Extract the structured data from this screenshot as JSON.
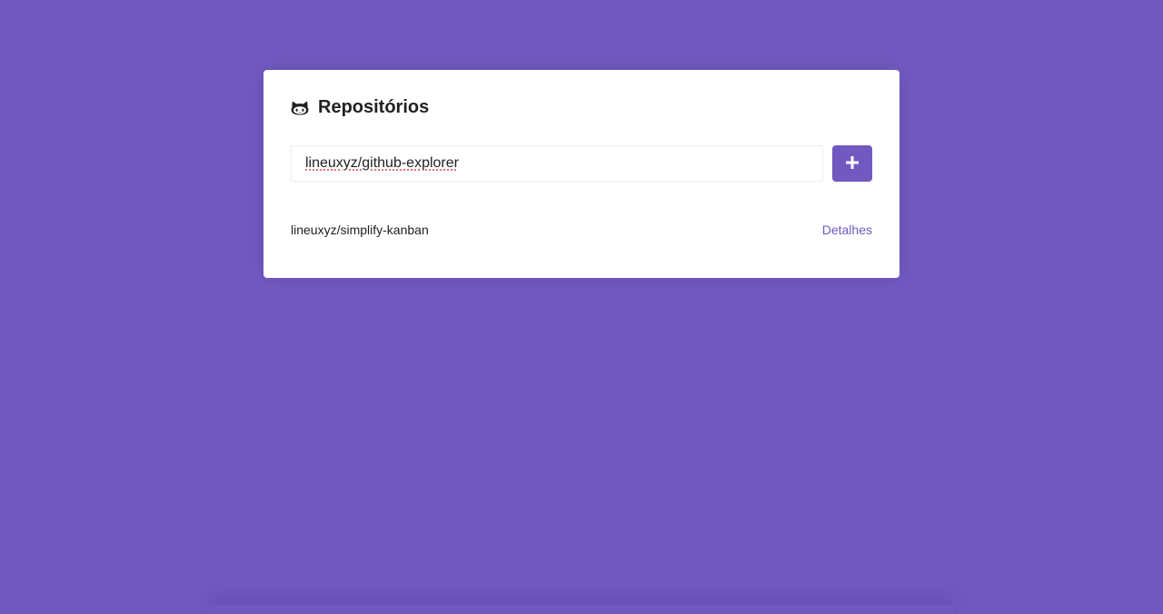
{
  "colors": {
    "background": "#7159c1",
    "accent": "#7159c1",
    "card": "#ffffff",
    "text": "#222222"
  },
  "header": {
    "icon": "github-icon",
    "title": "Repositórios"
  },
  "form": {
    "input_value": "lineuxyz/github-explorer",
    "submit_icon": "plus-icon"
  },
  "repositories": [
    {
      "name": "lineuxyz/simplify-kanban",
      "link_label": "Detalhes"
    }
  ]
}
